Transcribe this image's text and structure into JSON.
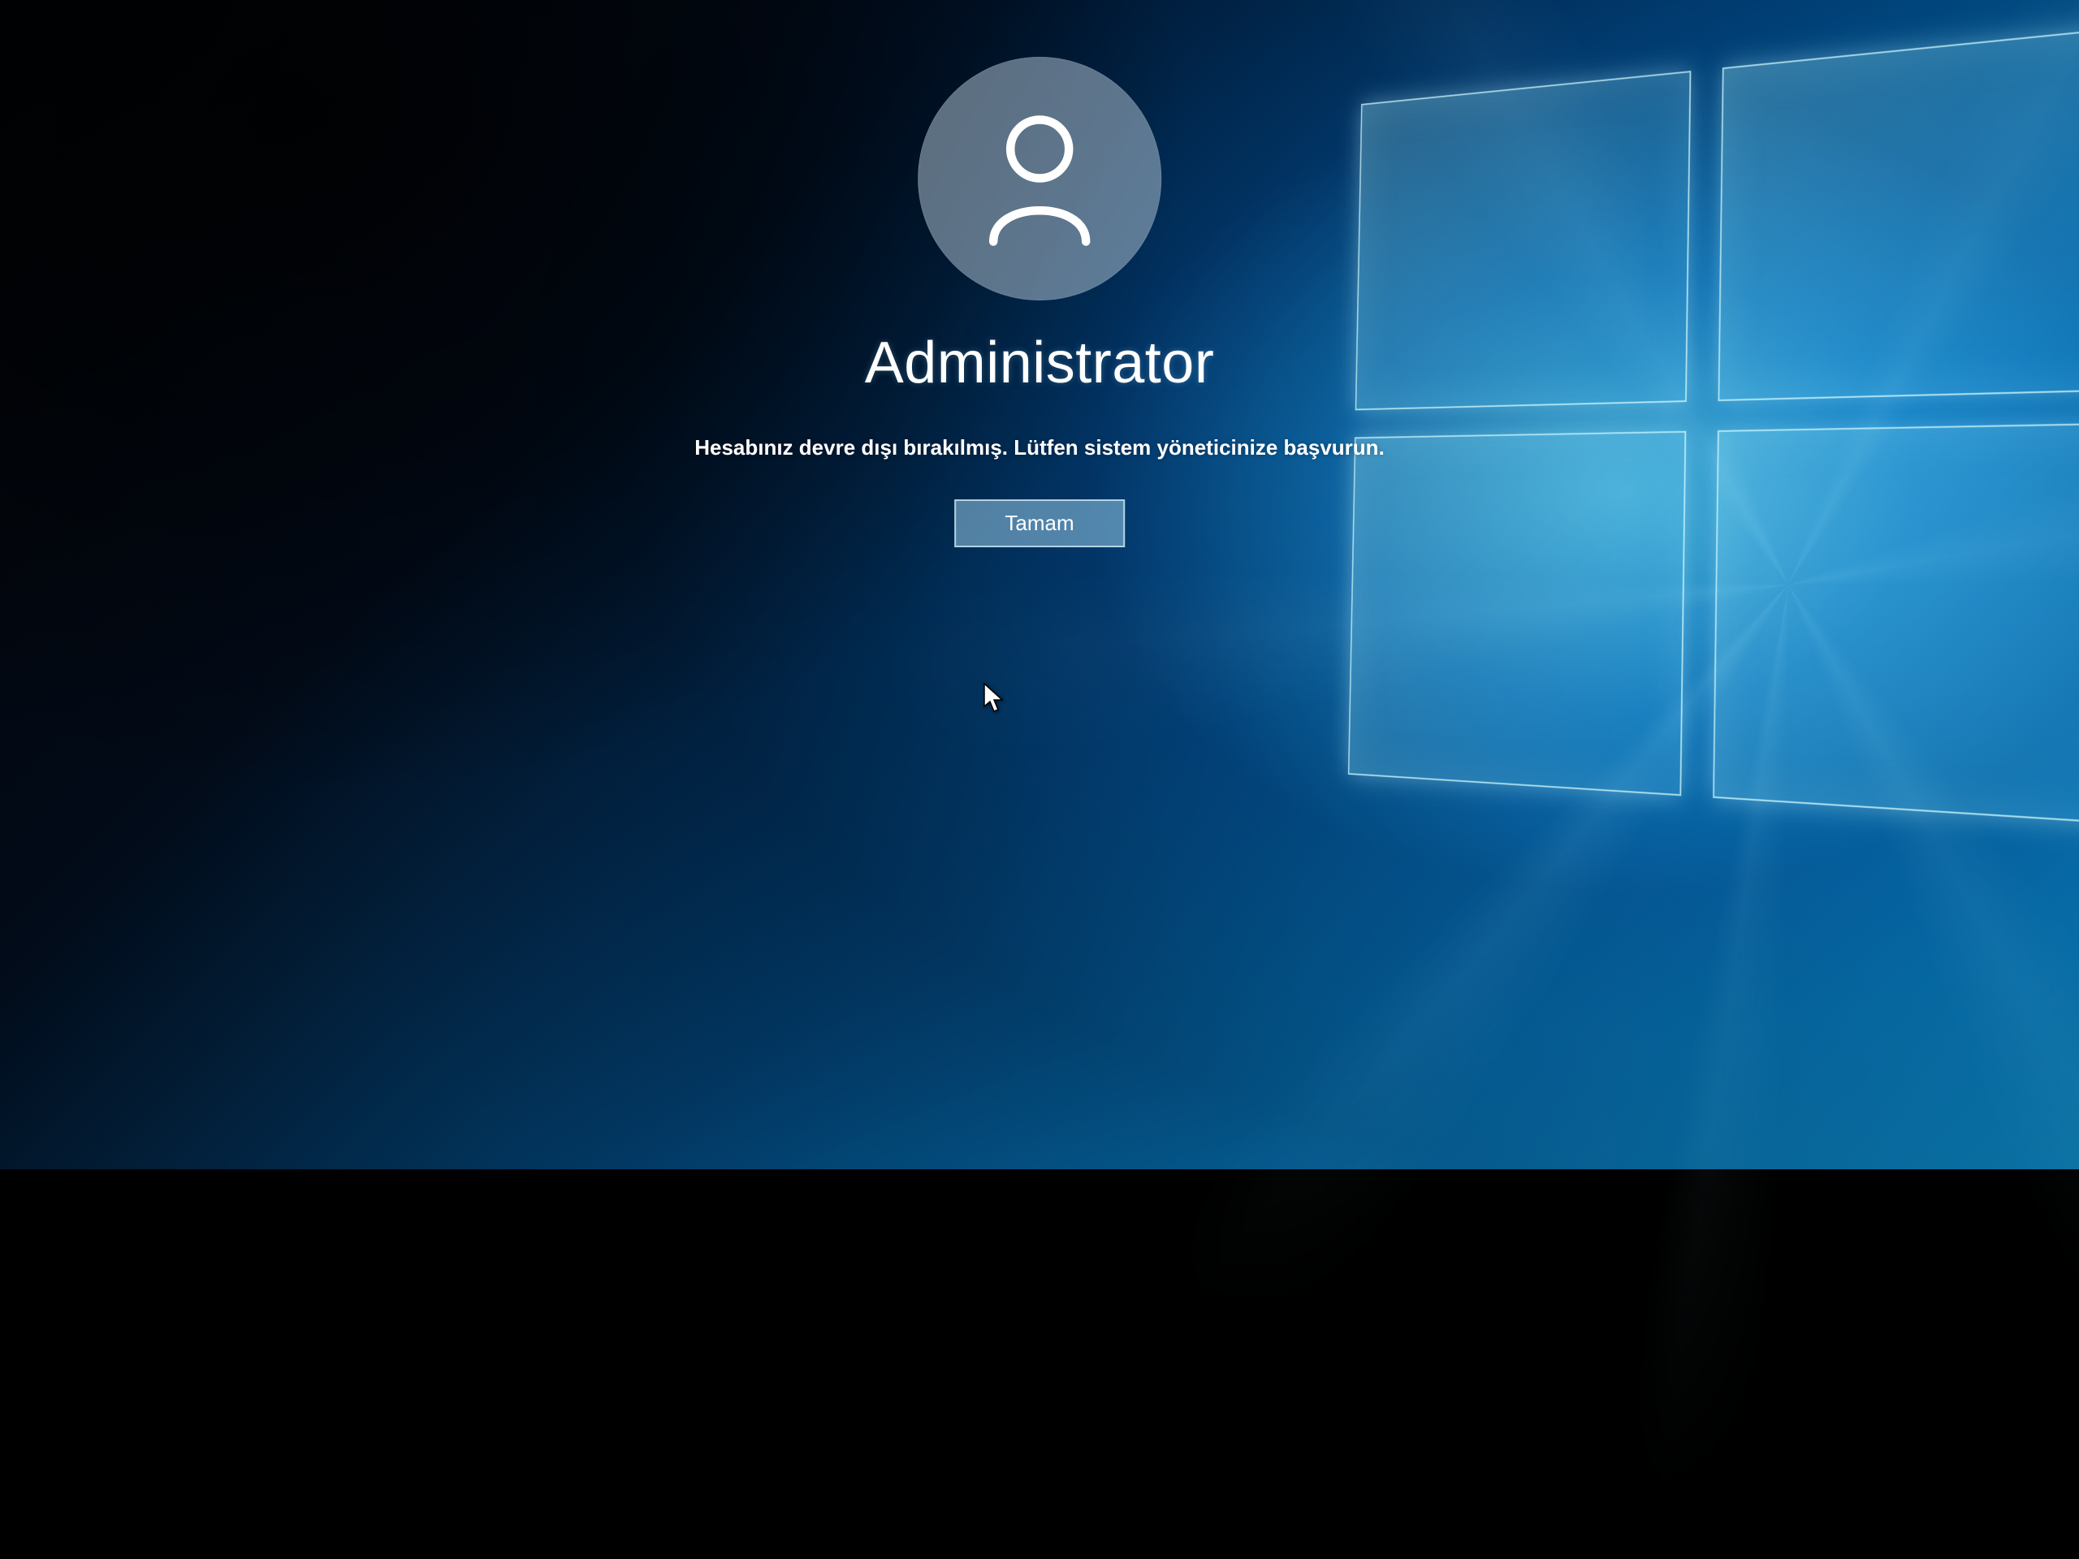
{
  "login": {
    "username": "Administrator",
    "message": "Hesabınız devre dışı bırakılmış.  Lütfen sistem yöneticinize başvurun.",
    "ok_label": "Tamam"
  },
  "colors": {
    "accent": "#0078d7",
    "button_bg": "rgba(150,200,230,0.55)",
    "text": "#ffffff"
  }
}
